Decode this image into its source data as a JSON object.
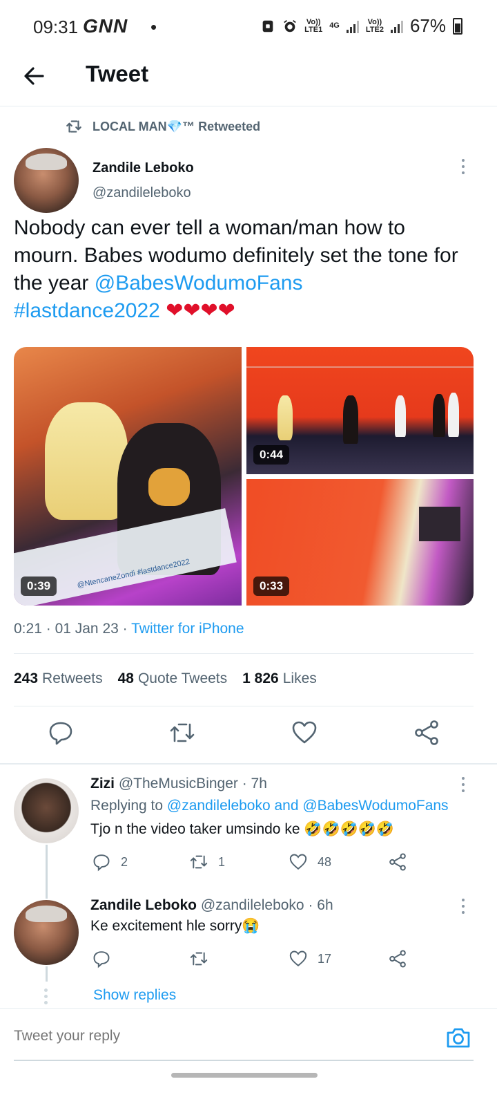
{
  "status_bar": {
    "time": "09:31",
    "carrier": "GNN",
    "dot": "•",
    "net1_top": "Vo))",
    "net1_bottom": "LTE1",
    "net_4g": "4G",
    "net2_top": "Vo))",
    "net2_bottom": "LTE2",
    "battery": "67%"
  },
  "header": {
    "title": "Tweet"
  },
  "retweet_line": {
    "text": "LOCAL MAN💎™ Retweeted"
  },
  "tweet": {
    "author_name": "Zandile Leboko",
    "author_handle": "@zandileleboko",
    "text_plain": "Nobody can ever tell a woman/man how to mourn. Babes wodumo definitely set the tone for the year ",
    "mention": "@BabesWodumoFans",
    "hashtag": "#lastdance2022",
    "hearts": "❤❤❤❤",
    "media": [
      {
        "duration": "0:39",
        "overlay_text": "@NtencaneZondi #lastdance2022"
      },
      {
        "duration": "0:44"
      },
      {
        "duration": "0:33"
      }
    ],
    "time": "0:21",
    "date": "01 Jan 23",
    "separator": "·",
    "source": "Twitter for iPhone",
    "stats": {
      "retweets_count": "243",
      "retweets_label": "Retweets",
      "quotes_count": "48",
      "quotes_label": "Quote Tweets",
      "likes_count": "1 826",
      "likes_label": "Likes"
    }
  },
  "replies": [
    {
      "name": "Zizi",
      "handle": "@TheMusicBinger",
      "age": "· 7h",
      "replying_prefix": "Replying to",
      "replying_targets": "@zandileleboko and @BabesWodumoFans",
      "text": "Tjo n the video taker umsindo ke 🤣🤣🤣🤣🤣",
      "reply_count": "2",
      "retweet_count": "1",
      "like_count": "48"
    },
    {
      "name": "Zandile Leboko",
      "handle": "@zandileleboko",
      "age": "· 6h",
      "text": "Ke excitement hle sorry😭",
      "reply_count": "",
      "retweet_count": "",
      "like_count": "17"
    }
  ],
  "show_replies": "Show replies",
  "composer": {
    "placeholder": "Tweet your reply"
  },
  "colors": {
    "accent": "#1d9bf0",
    "text_secondary": "#536471",
    "heart": "#e0102a"
  },
  "icons": [
    "back-arrow-icon",
    "retweet-icon",
    "more-vertical-icon",
    "reply-icon",
    "like-icon",
    "share-icon",
    "camera-icon",
    "alarm-icon",
    "lock-icon",
    "signal-icon",
    "battery-icon"
  ]
}
